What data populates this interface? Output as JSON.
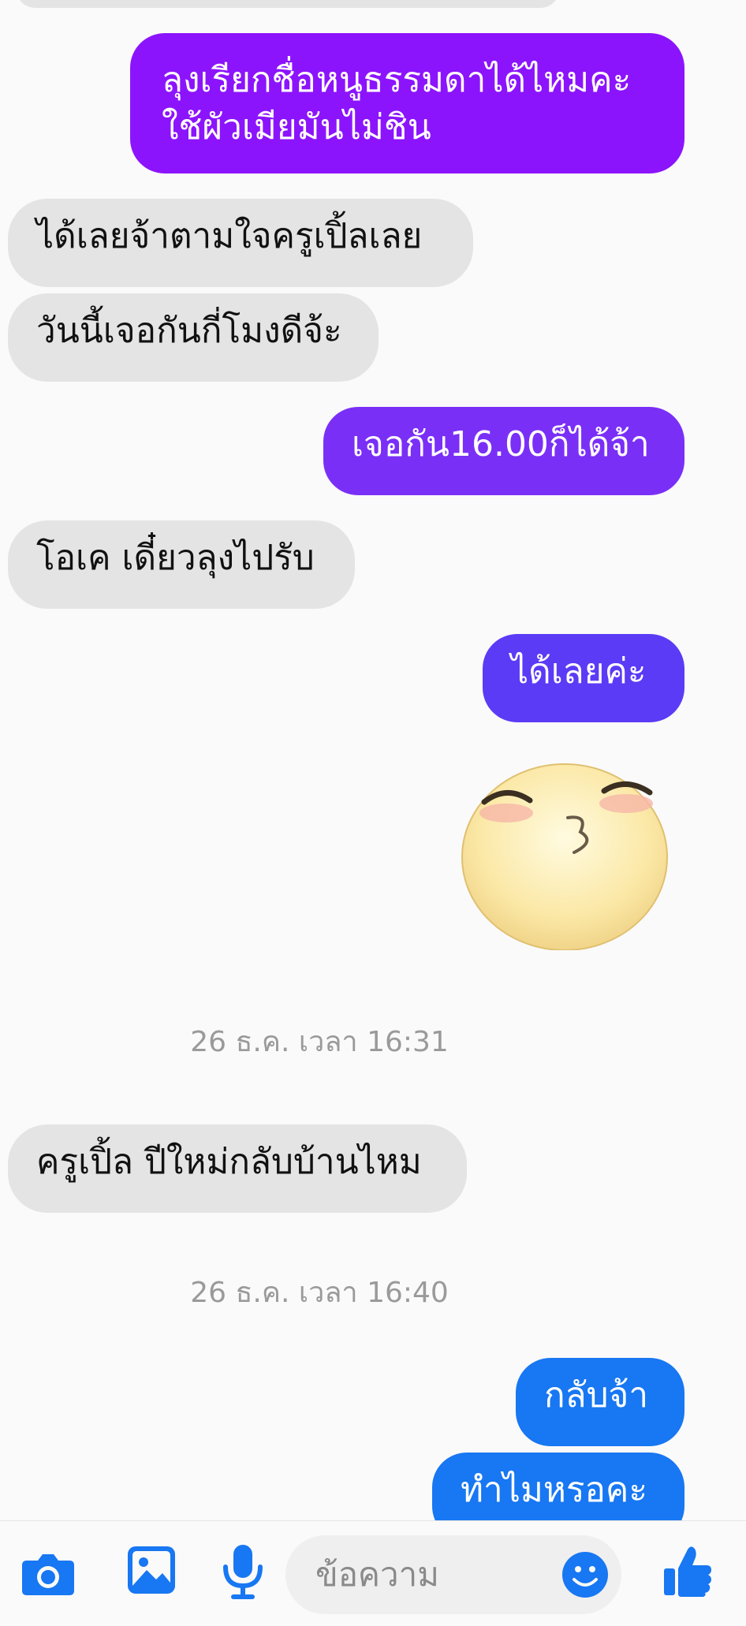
{
  "messages": [
    {
      "side": "out",
      "text": "ลุงเรียกชื่อหนูธรรมดาได้ไหมคะ\nใช้ผัวเมียมันไม่ชิน",
      "color": "#8c14fc"
    },
    {
      "side": "in",
      "text": "ได้เลยจ้าตามใจครูเปิ้ลเลย"
    },
    {
      "side": "in",
      "text": "วันนี้เจอกันกี่โมงดีจ้ะ"
    },
    {
      "side": "out",
      "text": "เจอกัน16.00ก็ได้จ้า",
      "color": "#7a2ff7"
    },
    {
      "side": "in",
      "text": "โอเค เดี๋ยวลุงไปรับ"
    },
    {
      "side": "out",
      "text": "ได้เลยค่ะ",
      "color": "#5b3bf5"
    }
  ],
  "timestamp_1": "26 ธ.ค. เวลา 16:31",
  "message_after_ts1": "ครูเปิ้ล ปีใหม่กลับบ้านไหม",
  "timestamp_2": "26 ธ.ค. เวลา 16:40",
  "late_messages": [
    {
      "side": "out",
      "text": "กลับจ้า",
      "color": "#1877f2"
    },
    {
      "side": "out",
      "text": "ทำไมหรอคะ",
      "color": "#1877f2"
    }
  ],
  "sticker": {
    "name": "kissing-face-sticker"
  },
  "composer": {
    "placeholder": "ข้อความ",
    "icons": [
      "camera-icon",
      "image-icon",
      "microphone-icon",
      "emoji-icon",
      "thumbs-up-icon"
    ],
    "accent": "#1877f2"
  }
}
